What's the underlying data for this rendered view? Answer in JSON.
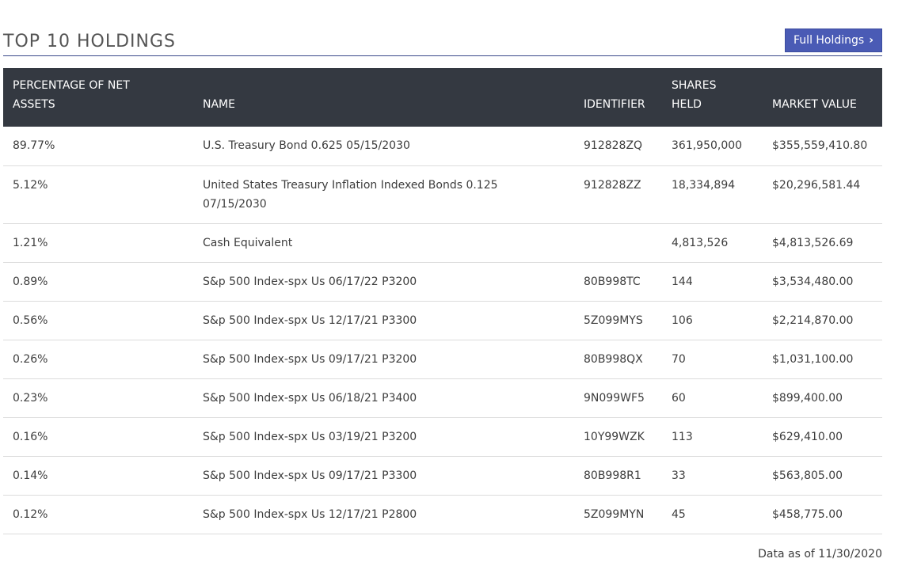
{
  "header": {
    "title": "TOP 10 HOLDINGS",
    "full_holdings_label": "Full Holdings",
    "chevron_glyph": "›"
  },
  "table": {
    "columns": {
      "pct": "PERCENTAGE OF NET ASSETS",
      "name": "NAME",
      "identifier": "IDENTIFIER",
      "shares": "SHARES HELD",
      "market_value": "MARKET VALUE"
    },
    "rows": [
      {
        "pct": "89.77%",
        "name": "U.S. Treasury Bond 0.625 05/15/2030",
        "identifier": "912828ZQ",
        "shares": "361,950,000",
        "market_value": "$355,559,410.80"
      },
      {
        "pct": "5.12%",
        "name": "United States Treasury Inflation Indexed Bonds 0.125 07/15/2030",
        "identifier": "912828ZZ",
        "shares": "18,334,894",
        "market_value": "$20,296,581.44"
      },
      {
        "pct": "1.21%",
        "name": "Cash Equivalent",
        "identifier": "",
        "shares": "4,813,526",
        "market_value": "$4,813,526.69"
      },
      {
        "pct": "0.89%",
        "name": "S&p 500 Index-spx Us 06/17/22 P3200",
        "identifier": "80B998TC",
        "shares": "144",
        "market_value": "$3,534,480.00"
      },
      {
        "pct": "0.56%",
        "name": "S&p 500 Index-spx Us 12/17/21 P3300",
        "identifier": "5Z099MYS",
        "shares": "106",
        "market_value": "$2,214,870.00"
      },
      {
        "pct": "0.26%",
        "name": "S&p 500 Index-spx Us 09/17/21 P3200",
        "identifier": "80B998QX",
        "shares": "70",
        "market_value": "$1,031,100.00"
      },
      {
        "pct": "0.23%",
        "name": "S&p 500 Index-spx Us 06/18/21 P3400",
        "identifier": "9N099WF5",
        "shares": "60",
        "market_value": "$899,400.00"
      },
      {
        "pct": "0.16%",
        "name": "S&p 500 Index-spx Us 03/19/21 P3200",
        "identifier": "10Y99WZK",
        "shares": "113",
        "market_value": "$629,410.00"
      },
      {
        "pct": "0.14%",
        "name": "S&p 500 Index-spx Us 09/17/21 P3300",
        "identifier": "80B998R1",
        "shares": "33",
        "market_value": "$563,805.00"
      },
      {
        "pct": "0.12%",
        "name": "S&p 500 Index-spx Us 12/17/21 P2800",
        "identifier": "5Z099MYN",
        "shares": "45",
        "market_value": "$458,775.00"
      }
    ]
  },
  "footer": {
    "data_as_of": "Data as of 11/30/2020"
  }
}
